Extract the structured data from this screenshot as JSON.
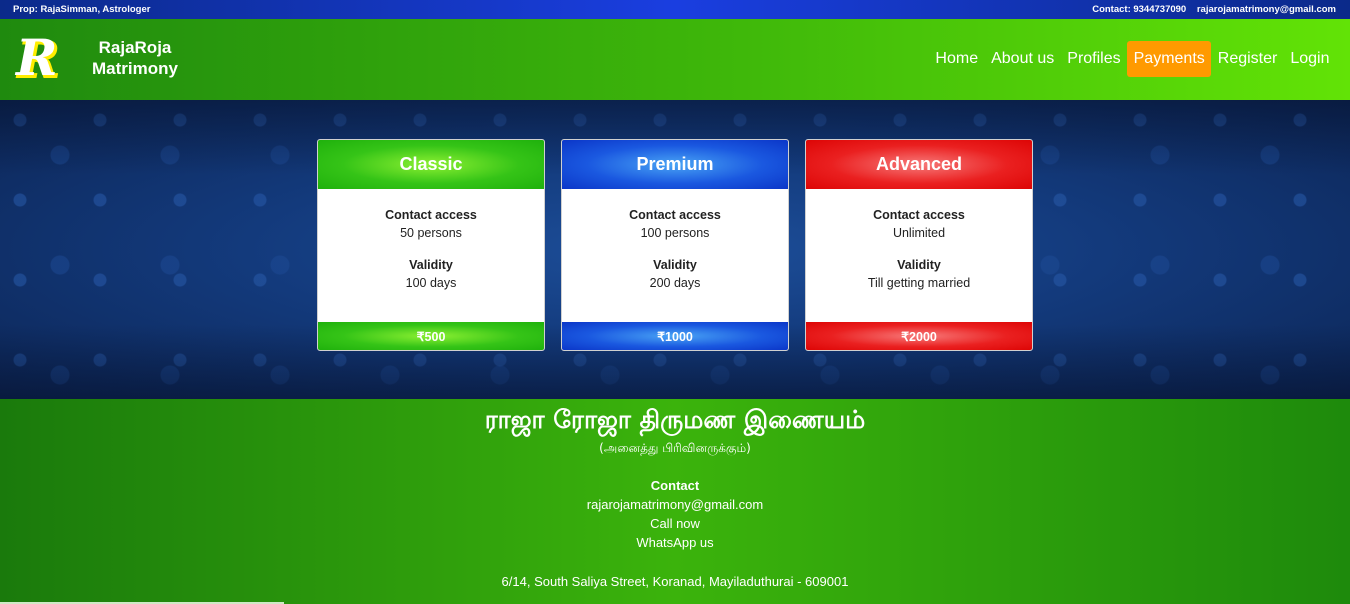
{
  "topbar": {
    "prop": "Prop: RajaSimman, Astrologer",
    "contact": "Contact: 9344737090",
    "email": "rajarojamatrimony@gmail.com"
  },
  "brand": {
    "logo_letter": "R",
    "line1": "RajaRoja",
    "line2": "Matrimony"
  },
  "nav": {
    "items": [
      "Home",
      "About us",
      "Profiles",
      "Payments",
      "Register",
      "Login"
    ],
    "active": "Payments"
  },
  "plans": [
    {
      "name": "Classic",
      "contact_label": "Contact access",
      "contact_value": "50 persons",
      "validity_label": "Validity",
      "validity_value": "100 days",
      "price": "₹500",
      "color": "#2cc214"
    },
    {
      "name": "Premium",
      "contact_label": "Contact access",
      "contact_value": "100 persons",
      "validity_label": "Validity",
      "validity_value": "200 days",
      "price": "₹1000",
      "color": "#1a58e0"
    },
    {
      "name": "Advanced",
      "contact_label": "Contact access",
      "contact_value": "Unlimited",
      "validity_label": "Validity",
      "validity_value": "Till getting married",
      "price": "₹2000",
      "color": "#e81414"
    }
  ],
  "footer": {
    "title": "ராஜா ரோஜா திருமண இணையம்",
    "subtitle": "(அனைத்து பிரிவினருக்கும்)",
    "contact_heading": "Contact",
    "email": "rajarojamatrimony@gmail.com",
    "call": "Call now",
    "whatsapp": "WhatsApp us",
    "address": "6/14, South Saliya Street, Koranad, Mayiladuthurai - 609001"
  },
  "colors": {
    "nav_active": "#ff9a00",
    "navbar_green": "#3fb80a",
    "hero_blue": "#133a7c"
  }
}
